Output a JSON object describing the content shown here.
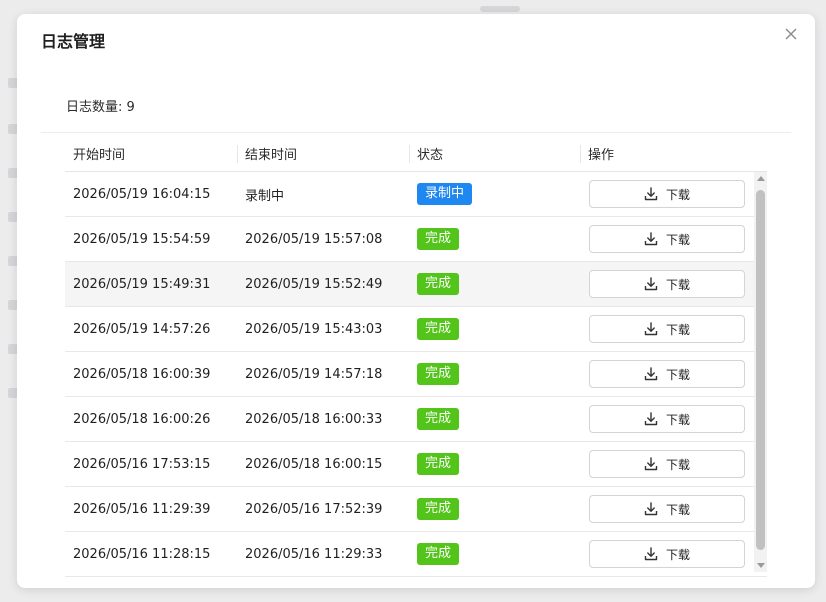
{
  "modal": {
    "title": "日志管理",
    "count_label": "日志数量: 9"
  },
  "table": {
    "headers": [
      "开始时间",
      "结束时间",
      "状态",
      "操作"
    ],
    "rows": [
      {
        "start": "2026/05/19 16:04:15",
        "end": "录制中",
        "status": "录制中",
        "status_color": "#1e87f0",
        "action": "下载"
      },
      {
        "start": "2026/05/19 15:54:59",
        "end": "2026/05/19 15:57:08",
        "status": "完成",
        "status_color": "#52c41a",
        "action": "下载"
      },
      {
        "start": "2026/05/19 15:49:31",
        "end": "2026/05/19 15:52:49",
        "status": "完成",
        "status_color": "#52c41a",
        "action": "下载"
      },
      {
        "start": "2026/05/19 14:57:26",
        "end": "2026/05/19 15:43:03",
        "status": "完成",
        "status_color": "#52c41a",
        "action": "下载"
      },
      {
        "start": "2026/05/18 16:00:39",
        "end": "2026/05/19 14:57:18",
        "status": "完成",
        "status_color": "#52c41a",
        "action": "下载"
      },
      {
        "start": "2026/05/18 16:00:26",
        "end": "2026/05/18 16:00:33",
        "status": "完成",
        "status_color": "#52c41a",
        "action": "下载"
      },
      {
        "start": "2026/05/16 17:53:15",
        "end": "2026/05/18 16:00:15",
        "status": "完成",
        "status_color": "#52c41a",
        "action": "下载"
      },
      {
        "start": "2026/05/16 11:29:39",
        "end": "2026/05/16 17:52:39",
        "status": "完成",
        "status_color": "#52c41a",
        "action": "下载"
      },
      {
        "start": "2026/05/16 11:28:15",
        "end": "2026/05/16 11:29:33",
        "status": "完成",
        "status_color": "#52c41a",
        "action": "下载"
      }
    ]
  },
  "icons": {
    "close": "close-icon",
    "download": "download-icon"
  }
}
